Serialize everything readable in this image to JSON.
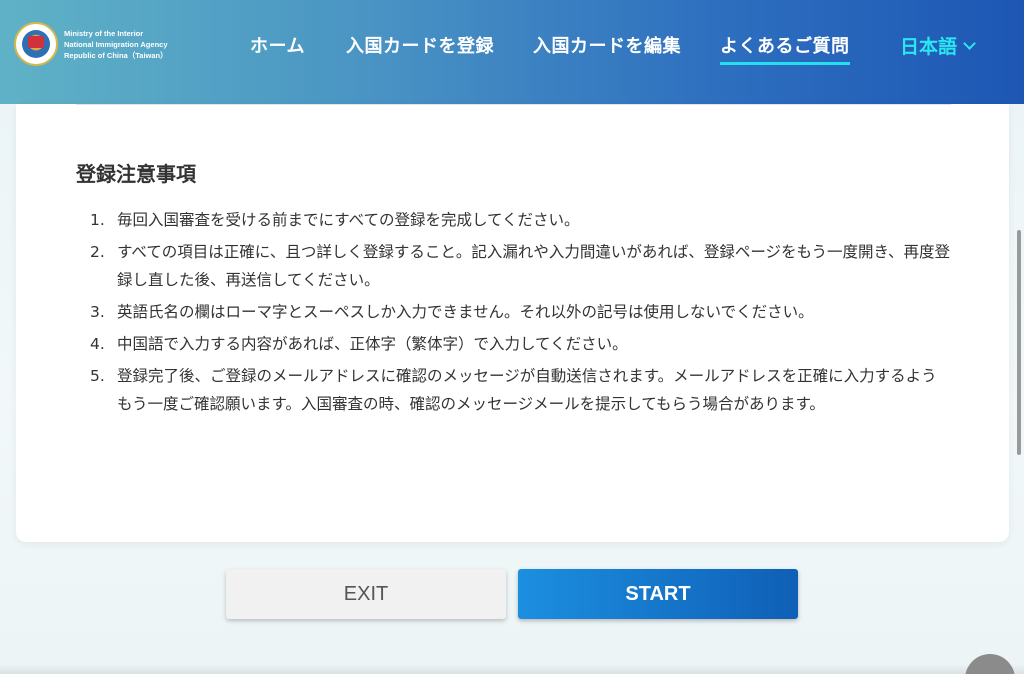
{
  "header": {
    "logo_lines": [
      "Ministry of the Interior",
      "National Immigration Agency",
      "Republic of China（Taiwan）"
    ],
    "nav": [
      {
        "label": "ホーム"
      },
      {
        "label": "入国カードを登録"
      },
      {
        "label": "入国カードを編集"
      },
      {
        "label": "よくあるご質問",
        "active": true
      }
    ],
    "language": "日本語"
  },
  "card": {
    "title": "登録注意事項",
    "notes": [
      {
        "num": "1.",
        "text": "毎回入国審査を受ける前までにすべての登録を完成してください。"
      },
      {
        "num": "2.",
        "text": "すべての項目は正確に、且つ詳しく登録すること。記入漏れや入力間違いがあれば、登録ページをもう一度開き、再度登録し直した後、再送信してください。"
      },
      {
        "num": "3.",
        "text": "英語氏名の欄はローマ字とスーペスしか入力できません。それ以外の記号は使用しないでください。"
      },
      {
        "num": "4.",
        "text": "中国語で入力する内容があれば、正体字（繁体字）で入力してください。"
      },
      {
        "num": "5.",
        "text": "登録完了後、ご登録のメールアドレスに確認のメッセージが自動送信されます。メールアドレスを正確に入力するようもう一度ご確認願います。入国審査の時、確認のメッセージメールを提示してもらう場合があります。"
      }
    ]
  },
  "buttons": {
    "exit": "EXIT",
    "start": "START"
  },
  "colors": {
    "accent": "#22e0f0",
    "start_button": "#1c8fe0",
    "header_dark": "#1d57b4"
  }
}
